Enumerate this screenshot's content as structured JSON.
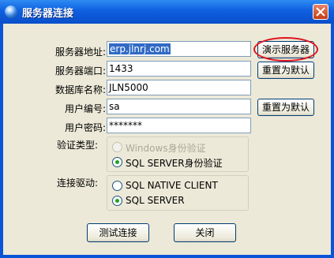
{
  "window": {
    "title": "服务器连接"
  },
  "form": {
    "server_address_label": "服务器地址:",
    "server_address_value": "erp.jlnrj.com",
    "server_port_label": "服务器端口:",
    "server_port_value": "1433",
    "database_label": "数据库名称:",
    "database_value": "JLN5000",
    "user_label": "用户编号:",
    "user_value": "sa",
    "password_label": "用户密码:",
    "password_value": "*******"
  },
  "auth": {
    "label": "验证类型:",
    "options": [
      "Windows身份验证",
      "SQL SERVER身份验证"
    ],
    "selected": "SQL SERVER身份验证"
  },
  "driver": {
    "label": "连接驱动:",
    "options": [
      "SQL NATIVE CLIENT",
      "SQL SERVER"
    ],
    "selected": "SQL SERVER"
  },
  "buttons": {
    "demo_server": "演示服务器",
    "reset_default_1": "重置为默认",
    "reset_default_2": "重置为默认",
    "test_connection": "测试连接",
    "close": "关闭"
  },
  "colors": {
    "highlight": "#e0141e",
    "selection": "#316ac5",
    "titlebar": "#0a54d8"
  }
}
